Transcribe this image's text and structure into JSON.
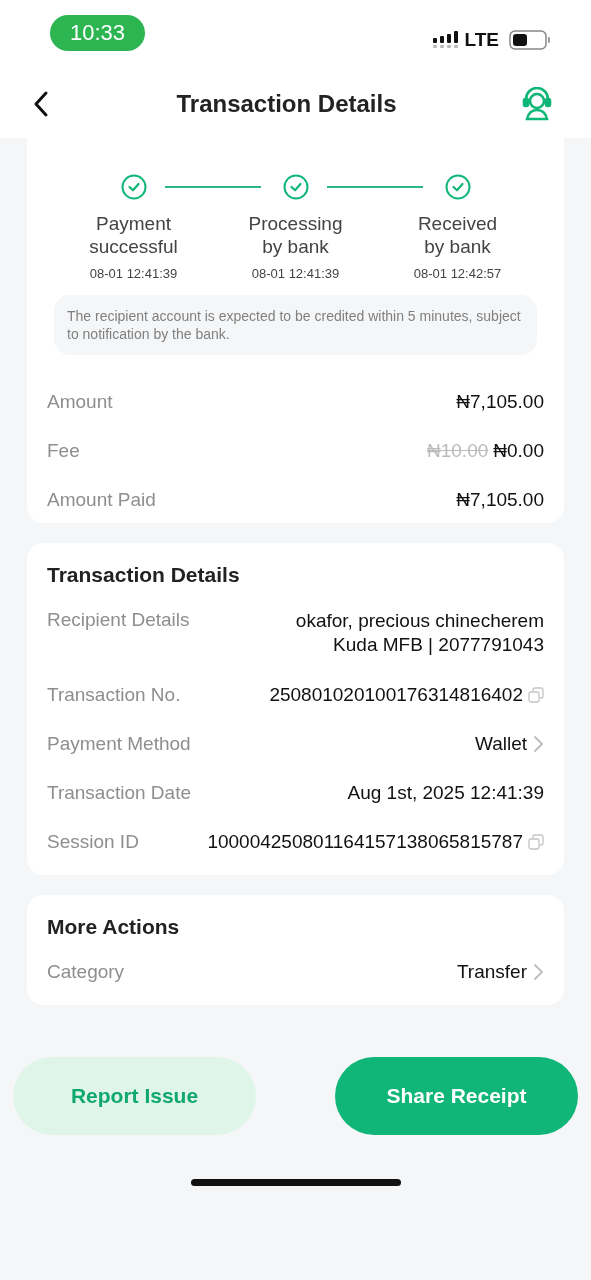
{
  "status_bar": {
    "time": "10:33",
    "network": "LTE"
  },
  "nav": {
    "title": "Transaction Details"
  },
  "progress": {
    "steps": [
      {
        "label": [
          "Payment",
          "successful"
        ],
        "time": "08-01 12:41:39",
        "done": true
      },
      {
        "label": [
          "Processing",
          "by bank"
        ],
        "time": "08-01 12:41:39",
        "done": true
      },
      {
        "label": [
          "Received",
          "by bank"
        ],
        "time": "08-01 12:42:57",
        "done": true
      }
    ],
    "note": "The recipient account is expected to be credited within 5 minutes, subject to notification by the bank."
  },
  "amounts": [
    {
      "kind": "text",
      "label": "Amount",
      "value": "₦7,105.00"
    },
    {
      "kind": "fee",
      "label": "Fee",
      "old_value": "₦10.00",
      "value": "₦0.00"
    },
    {
      "kind": "text",
      "label": "Amount Paid",
      "value": "₦7,105.00"
    }
  ],
  "details": {
    "title": "Transaction Details",
    "rows": [
      {
        "kind": "lines",
        "label": "Recipient Details",
        "lines": [
          "okafor, precious chinecherem",
          "Kuda MFB | 2077791043"
        ]
      },
      {
        "kind": "copy",
        "label": "Transaction No.",
        "value": "250801020100176314816402"
      },
      {
        "kind": "link",
        "label": "Payment Method",
        "value": "Wallet"
      },
      {
        "kind": "text",
        "label": "Transaction Date",
        "value": "Aug 1st, 2025 12:41:39"
      },
      {
        "kind": "copy",
        "label": "Session ID",
        "value": "100004250801164157138065815787"
      }
    ]
  },
  "more_actions": {
    "title": "More Actions",
    "rows": [
      {
        "kind": "link",
        "label": "Category",
        "value": "Transfer"
      }
    ]
  },
  "buttons": [
    {
      "kind": "secondary",
      "label": "Report Issue"
    },
    {
      "kind": "primary",
      "label": "Share Receipt"
    }
  ]
}
